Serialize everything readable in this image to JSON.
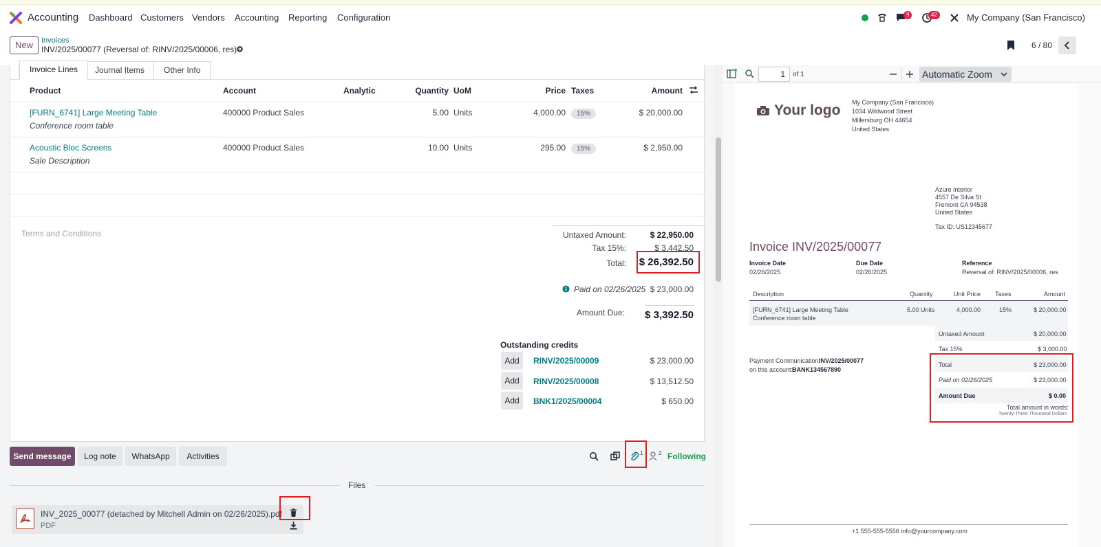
{
  "navbar": {
    "app_name": "Accounting",
    "menu": [
      "Dashboard",
      "Customers",
      "Vendors",
      "Accounting",
      "Reporting",
      "Configuration"
    ],
    "messages_badge": "9",
    "activities_badge": "42",
    "company": "My Company (San Francisco)"
  },
  "control": {
    "new_label": "New",
    "breadcrumb_parent": "Invoices",
    "record_title": "INV/2025/00077 (Reversal of: RINV/2025/00006, res)",
    "pager": "6 / 80"
  },
  "tabs": [
    "Invoice Lines",
    "Journal Items",
    "Other Info"
  ],
  "lines": {
    "headers": {
      "product": "Product",
      "account": "Account",
      "analytic": "Analytic",
      "quantity": "Quantity",
      "uom": "UoM",
      "price": "Price",
      "taxes": "Taxes",
      "amount": "Amount"
    },
    "rows": [
      {
        "product": "[FURN_6741] Large Meeting Table",
        "description": "Conference room table",
        "account": "400000 Product Sales",
        "quantity": "5.00",
        "uom": "Units",
        "price": "4,000.00",
        "tax": "15%",
        "amount": "$ 20,000.00"
      },
      {
        "product": "Acoustic Bloc Screens",
        "description": "Sale Description",
        "account": "400000 Product Sales",
        "quantity": "10.00",
        "uom": "Units",
        "price": "295.00",
        "tax": "15%",
        "amount": "$ 2,950.00"
      }
    ]
  },
  "terms_placeholder": "Terms and Conditions",
  "totals": {
    "untaxed_label": "Untaxed Amount:",
    "untaxed_value": "$ 22,950.00",
    "tax_label": "Tax 15%:",
    "tax_value": "$ 3,442.50",
    "total_label": "Total:",
    "total_value": "$ 26,392.50",
    "paid_label": "Paid on 02/26/2025",
    "paid_value": "$ 23,000.00",
    "due_label": "Amount Due:",
    "due_value": "$ 3,392.50"
  },
  "outstanding": {
    "title": "Outstanding credits",
    "add_label": "Add",
    "items": [
      {
        "ref": "RINV/2025/00009",
        "amount": "$ 23,000.00"
      },
      {
        "ref": "RINV/2025/00008",
        "amount": "$ 13,512.50"
      },
      {
        "ref": "BNK1/2025/00004",
        "amount": "$ 650.00"
      }
    ]
  },
  "chatter": {
    "send_message": "Send message",
    "log_note": "Log note",
    "whatsapp": "WhatsApp",
    "activities": "Activities",
    "attachments_count": "1",
    "followers_count": "2",
    "following": "Following",
    "files_title": "Files",
    "file_name": "INV_2025_00077 (detached by Mitchell Admin on 02/26/2025).pdf",
    "file_type": "PDF"
  },
  "pdf_viewer": {
    "page_input": "1",
    "page_of": "of 1",
    "zoom": "Automatic Zoom"
  },
  "pdf": {
    "logo": "Your logo",
    "company_lines": [
      "My Company (San Francisco)",
      "1034 Wildwood Street",
      "Millersburg OH 44654",
      "United States"
    ],
    "customer_lines": [
      "Azure Interior",
      "4557 De Silva St",
      "Fremont CA 94538",
      "United States"
    ],
    "tax_id": "Tax ID: US12345677",
    "title": "Invoice INV/2025/00077",
    "invoice_date_label": "Invoice Date",
    "invoice_date": "02/26/2025",
    "due_date_label": "Due Date",
    "due_date": "02/26/2025",
    "reference_label": "Reference",
    "reference": "Reversal of: RINV/2025/00006, res",
    "col_description": "Description",
    "col_quantity": "Quantity",
    "col_unit_price": "Unit Price",
    "col_taxes": "Taxes",
    "col_amount": "Amount",
    "line_desc1": "[FURN_6741] Large Meeting Table",
    "line_desc2": "Conference room table",
    "line_qty": "5.00 Units",
    "line_price": "4,000.00",
    "line_tax": "15%",
    "line_amount": "$ 20,000.00",
    "untaxed_label": "Untaxed Amount",
    "untaxed_value": "$ 20,000.00",
    "tax_label": "Tax 15%",
    "tax_value": "$ 3,000.00",
    "total_label": "Total",
    "total_value": "$ 23,000.00",
    "paid_label": "Paid on 02/26/2025",
    "paid_value": "$ 23,000.00",
    "due_label": "Amount Due",
    "due_value": "$ 0.00",
    "words_label": "Total amount in words:",
    "words_value": "Twenty-Three Thousand Dollars",
    "payment_comm_label": "Payment Communication:",
    "payment_comm_value": "INV/2025/00077",
    "account_label": "on this account:",
    "account_value": "BANK134567890",
    "footer": "+1 555-555-5556 info@yourcompany.com"
  }
}
